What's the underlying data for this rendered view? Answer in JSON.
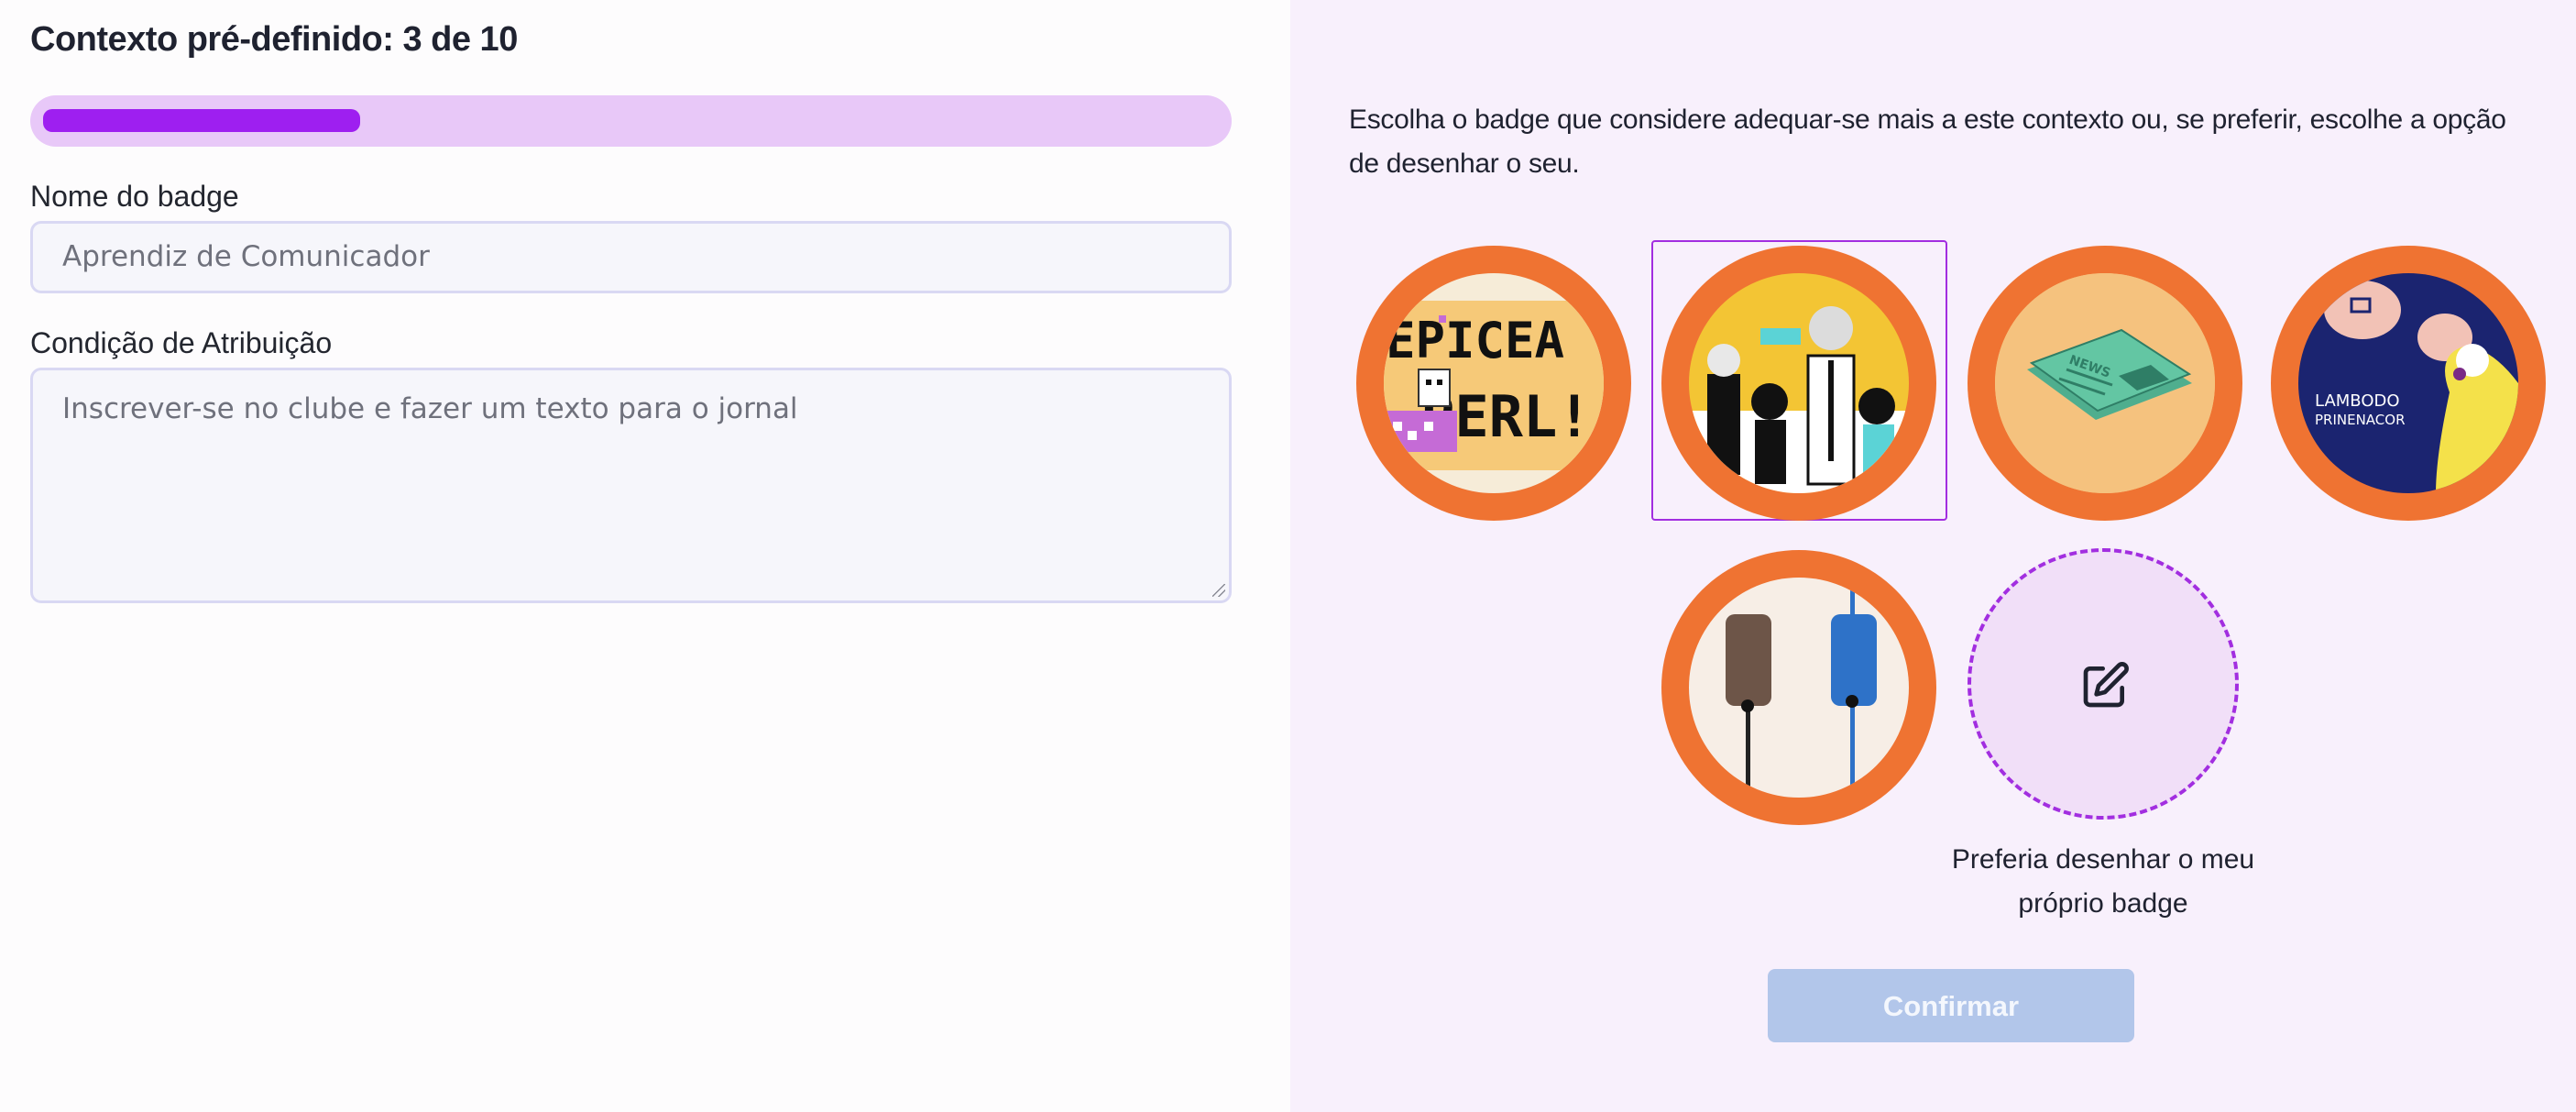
{
  "left_panel": {
    "title": "Contexto pré-definido: 3 de 10",
    "progress": {
      "current": 3,
      "total": 10,
      "fraction": 0.27
    },
    "name_label": "Nome do badge",
    "name_placeholder": "Aprendiz de Comunicador",
    "condition_label": "Condição de Atribuição",
    "condition_placeholder": "Inscrever-se no clube e fazer um texto para o jornal"
  },
  "right_panel": {
    "instructions": "Escolha o badge que considere adequar-se mais a este contexto ou, se preferir, escolhe a opção de desenhar o seu.",
    "badges": [
      {
        "name": "badge-epicerl",
        "text": "EPICEA PERL!",
        "selected": false
      },
      {
        "name": "badge-speakers",
        "selected": true
      },
      {
        "name": "badge-newspaper",
        "text": "NEWS",
        "selected": false
      },
      {
        "name": "badge-lambodo",
        "text": "LAMBODO PRINENACOR",
        "selected": false
      },
      {
        "name": "badge-microphones",
        "selected": false
      }
    ],
    "draw_option_label": "Preferia desenhar o meu próprio badge",
    "confirm_label": "Confirmar"
  },
  "colors": {
    "accent": "#9e1ff0",
    "badge_ring": "#ef7332",
    "confirm_disabled": "#b2c6ea",
    "right_bg": "#f8f0fc"
  }
}
